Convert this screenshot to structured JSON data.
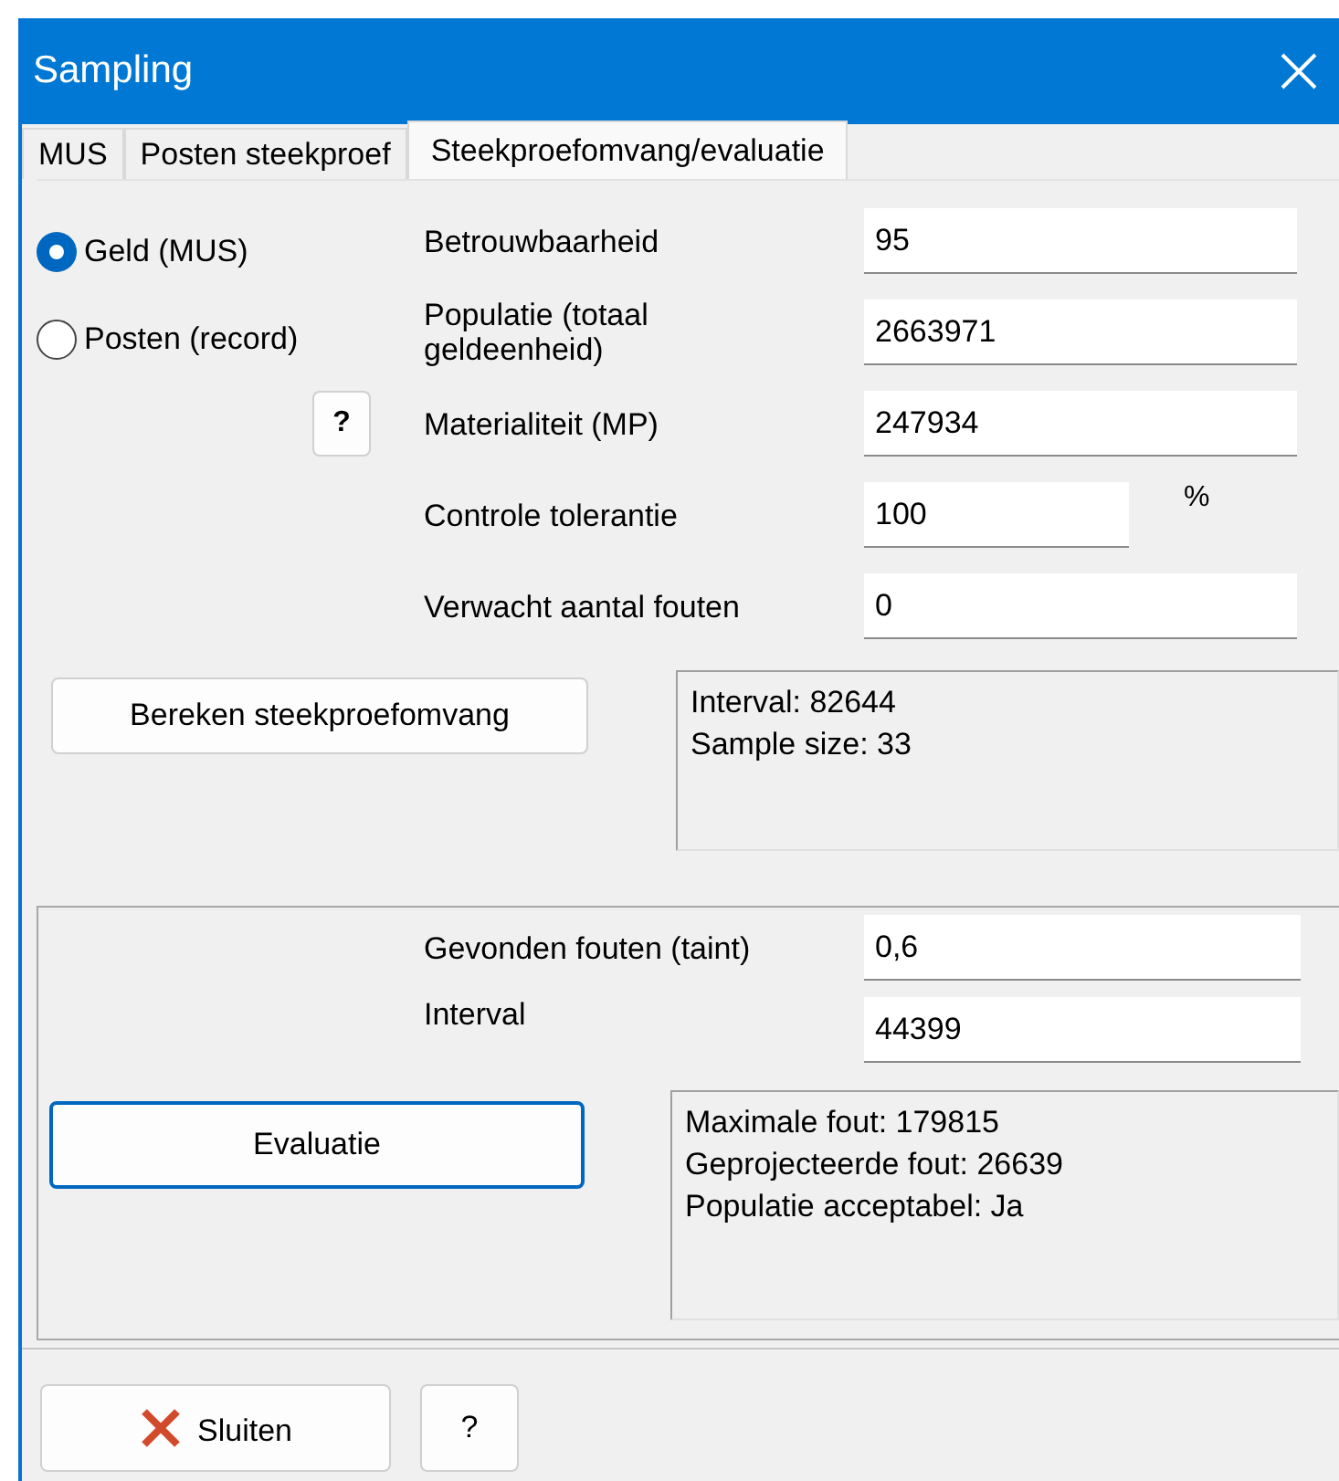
{
  "window": {
    "title": "Sampling"
  },
  "tabs": [
    {
      "label": "MUS",
      "selected": false
    },
    {
      "label": "Posten steekproef",
      "selected": false
    },
    {
      "label": "Steekproefomvang/evaluatie",
      "selected": true
    }
  ],
  "method_options": [
    {
      "label": "Geld (MUS)",
      "selected": true
    },
    {
      "label": "Posten (record)",
      "selected": false
    }
  ],
  "help_button": "?",
  "parameters": [
    {
      "label": "Betrouwbaarheid",
      "value": "95"
    },
    {
      "label": "Populatie (totaal geldeenheid)",
      "value": "2663971"
    },
    {
      "label": "Materialiteit (MP)",
      "value": "247934"
    },
    {
      "label": "Controle tolerantie",
      "value": "100",
      "unit": "%"
    },
    {
      "label": "Verwacht aantal fouten",
      "value": "0"
    }
  ],
  "calculate_button": {
    "label": "Bereken steekproefomvang",
    "default": false
  },
  "sample_result": [
    "Interval: 82644",
    "Sample size: 33"
  ],
  "evaluation": {
    "fields": [
      {
        "label": "Gevonden fouten (taint)",
        "value": "0,6"
      },
      {
        "label": "Interval",
        "value": "44399"
      }
    ],
    "button": {
      "label": "Evaluatie",
      "default": true
    },
    "result": [
      "Maximale fout: 179815",
      "Geprojecteerde fout: 26639",
      "Populatie acceptabel: Ja"
    ]
  },
  "footer": {
    "close_button": "Sluiten",
    "help_button": "?"
  }
}
